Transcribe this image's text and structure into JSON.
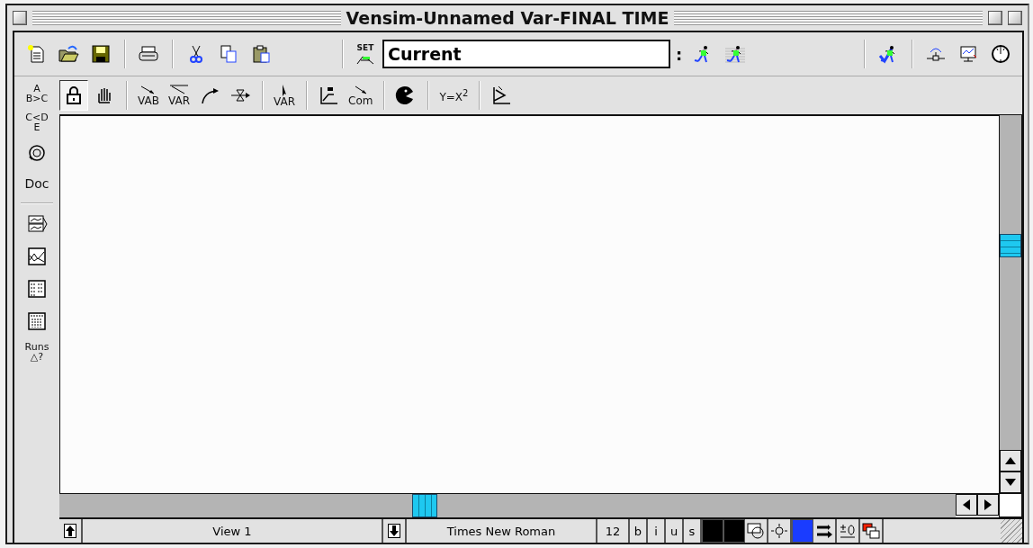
{
  "window": {
    "title": "Vensim-Unnamed Var-FINAL TIME"
  },
  "main_toolbar": {
    "set_label": "SET",
    "run_name": "Current",
    "divider_mark": ":"
  },
  "sketch_tool_groups": [
    [
      {
        "selected": true
      },
      {
        "selected": false
      }
    ],
    [
      {
        "label": "VAB",
        "selected": false
      },
      {
        "label": "VAR",
        "selected": false
      },
      {
        "selected": false
      },
      {
        "selected": false
      }
    ],
    [
      {
        "label": "VAR",
        "selected": false
      }
    ],
    [
      {
        "selected": false
      },
      {
        "label": "Com",
        "selected": false
      }
    ],
    [
      {
        "selected": false
      }
    ],
    [
      {
        "label": "Y=X$^{2}$",
        "selected": false
      }
    ],
    [
      {
        "selected": false
      }
    ]
  ],
  "analysis_tools": [
    {
      "kind": "text",
      "lines": [
        "A",
        "B>C"
      ]
    },
    {
      "kind": "text",
      "lines": [
        "C<D",
        "E"
      ]
    },
    {
      "kind": "icon"
    },
    {
      "kind": "text",
      "lines": [
        "Doc"
      ]
    },
    {
      "kind": "separator"
    },
    {
      "kind": "icon"
    },
    {
      "kind": "icon"
    },
    {
      "kind": "icon"
    },
    {
      "kind": "icon"
    },
    {
      "kind": "text",
      "lines": [
        "Runs",
        "△?"
      ]
    }
  ],
  "status_bar": {
    "view_name": "View 1",
    "font": "Times New Roman",
    "size": "12",
    "styles": [
      {
        "label": "b",
        "on": false
      },
      {
        "label": "i",
        "on": false
      },
      {
        "label": "u",
        "on": false
      },
      {
        "label": "s",
        "on": false
      }
    ],
    "swatches": [
      {
        "color": "#000000"
      },
      {
        "color": "#000000"
      },
      {
        "color": "#1a3cff"
      }
    ]
  }
}
